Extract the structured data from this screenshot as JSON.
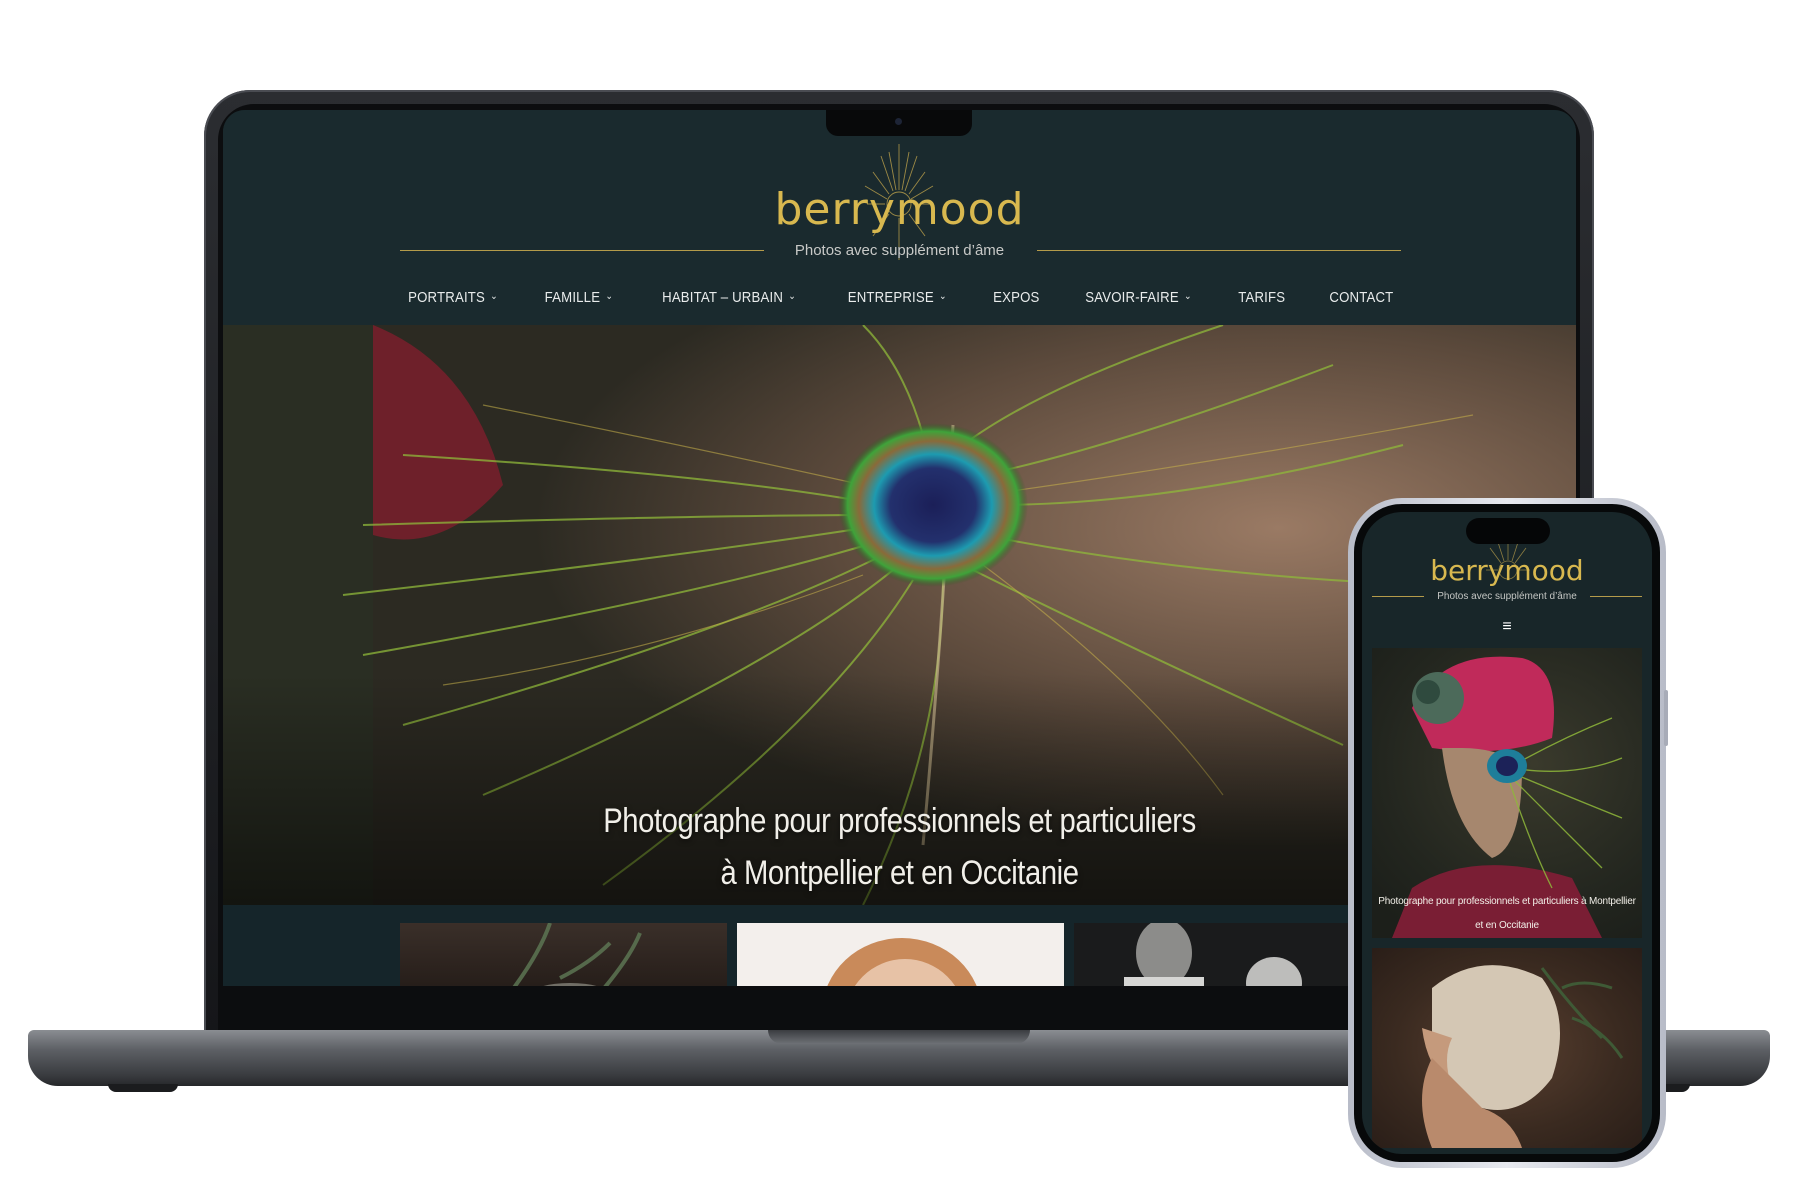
{
  "site": {
    "brand": "berrymood",
    "tagline": "Photos avec supplément d’âme"
  },
  "nav": [
    {
      "label": "PORTRAITS",
      "has_submenu": true
    },
    {
      "label": "FAMILLE",
      "has_submenu": true
    },
    {
      "label": "HABITAT – URBAIN",
      "has_submenu": true
    },
    {
      "label": "ENTREPRISE",
      "has_submenu": true
    },
    {
      "label": "EXPOS",
      "has_submenu": false
    },
    {
      "label": "SAVOIR-FAIRE",
      "has_submenu": true
    },
    {
      "label": "TARIFS",
      "has_submenu": false
    },
    {
      "label": "CONTACT",
      "has_submenu": false
    }
  ],
  "hero": {
    "line1": "Photographe pour professionnels et particuliers",
    "line2": "à Montpellier et en Occitanie"
  },
  "mobile": {
    "brand": "berrymood",
    "tagline": "Photos avec supplément d’âme",
    "hero_text": "Photographe pour professionnels et particuliers à Montpellier et en Occitanie",
    "menu_icon": "hamburger-icon"
  },
  "colors": {
    "background": "#1a2a2e",
    "brand_gold": "#d8b84f",
    "nav_text": "#e9ecec"
  },
  "icons": {
    "submenu": "chevron-down-icon",
    "logo_mark": "sunburst-icon"
  }
}
